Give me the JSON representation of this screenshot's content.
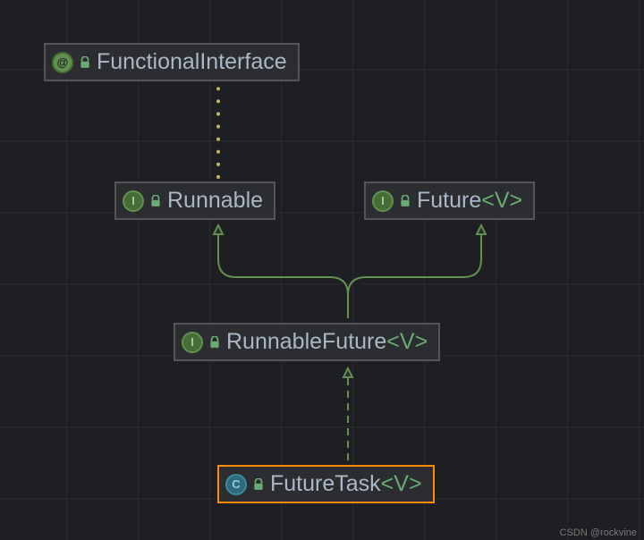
{
  "nodes": {
    "functionalInterface": {
      "label": "FunctionalInterface",
      "kind": "annotation",
      "badge": "@"
    },
    "runnable": {
      "label": "Runnable",
      "kind": "interface",
      "badge": "I"
    },
    "future": {
      "label": "Future",
      "generic": "<V>",
      "kind": "interface",
      "badge": "I"
    },
    "runnableFuture": {
      "label": "RunnableFuture",
      "generic": "<V>",
      "kind": "interface",
      "badge": "I"
    },
    "futureTask": {
      "label": "FutureTask",
      "generic": "<V>",
      "kind": "class",
      "badge": "C",
      "selected": true
    }
  },
  "edges": [
    {
      "from": "runnable",
      "to": "functionalInterface",
      "style": "dotted-yellow",
      "head": "none"
    },
    {
      "from": "runnableFuture",
      "to": "runnable",
      "style": "solid-green",
      "head": "hollow"
    },
    {
      "from": "runnableFuture",
      "to": "future",
      "style": "solid-green",
      "head": "hollow"
    },
    {
      "from": "futureTask",
      "to": "runnableFuture",
      "style": "dashed-green",
      "head": "hollow"
    }
  ],
  "watermark": "CSDN @rockvine",
  "colors": {
    "arrowGreen": "#62904f",
    "dottedYellow": "#c1b562",
    "selection": "#ff8c00"
  }
}
